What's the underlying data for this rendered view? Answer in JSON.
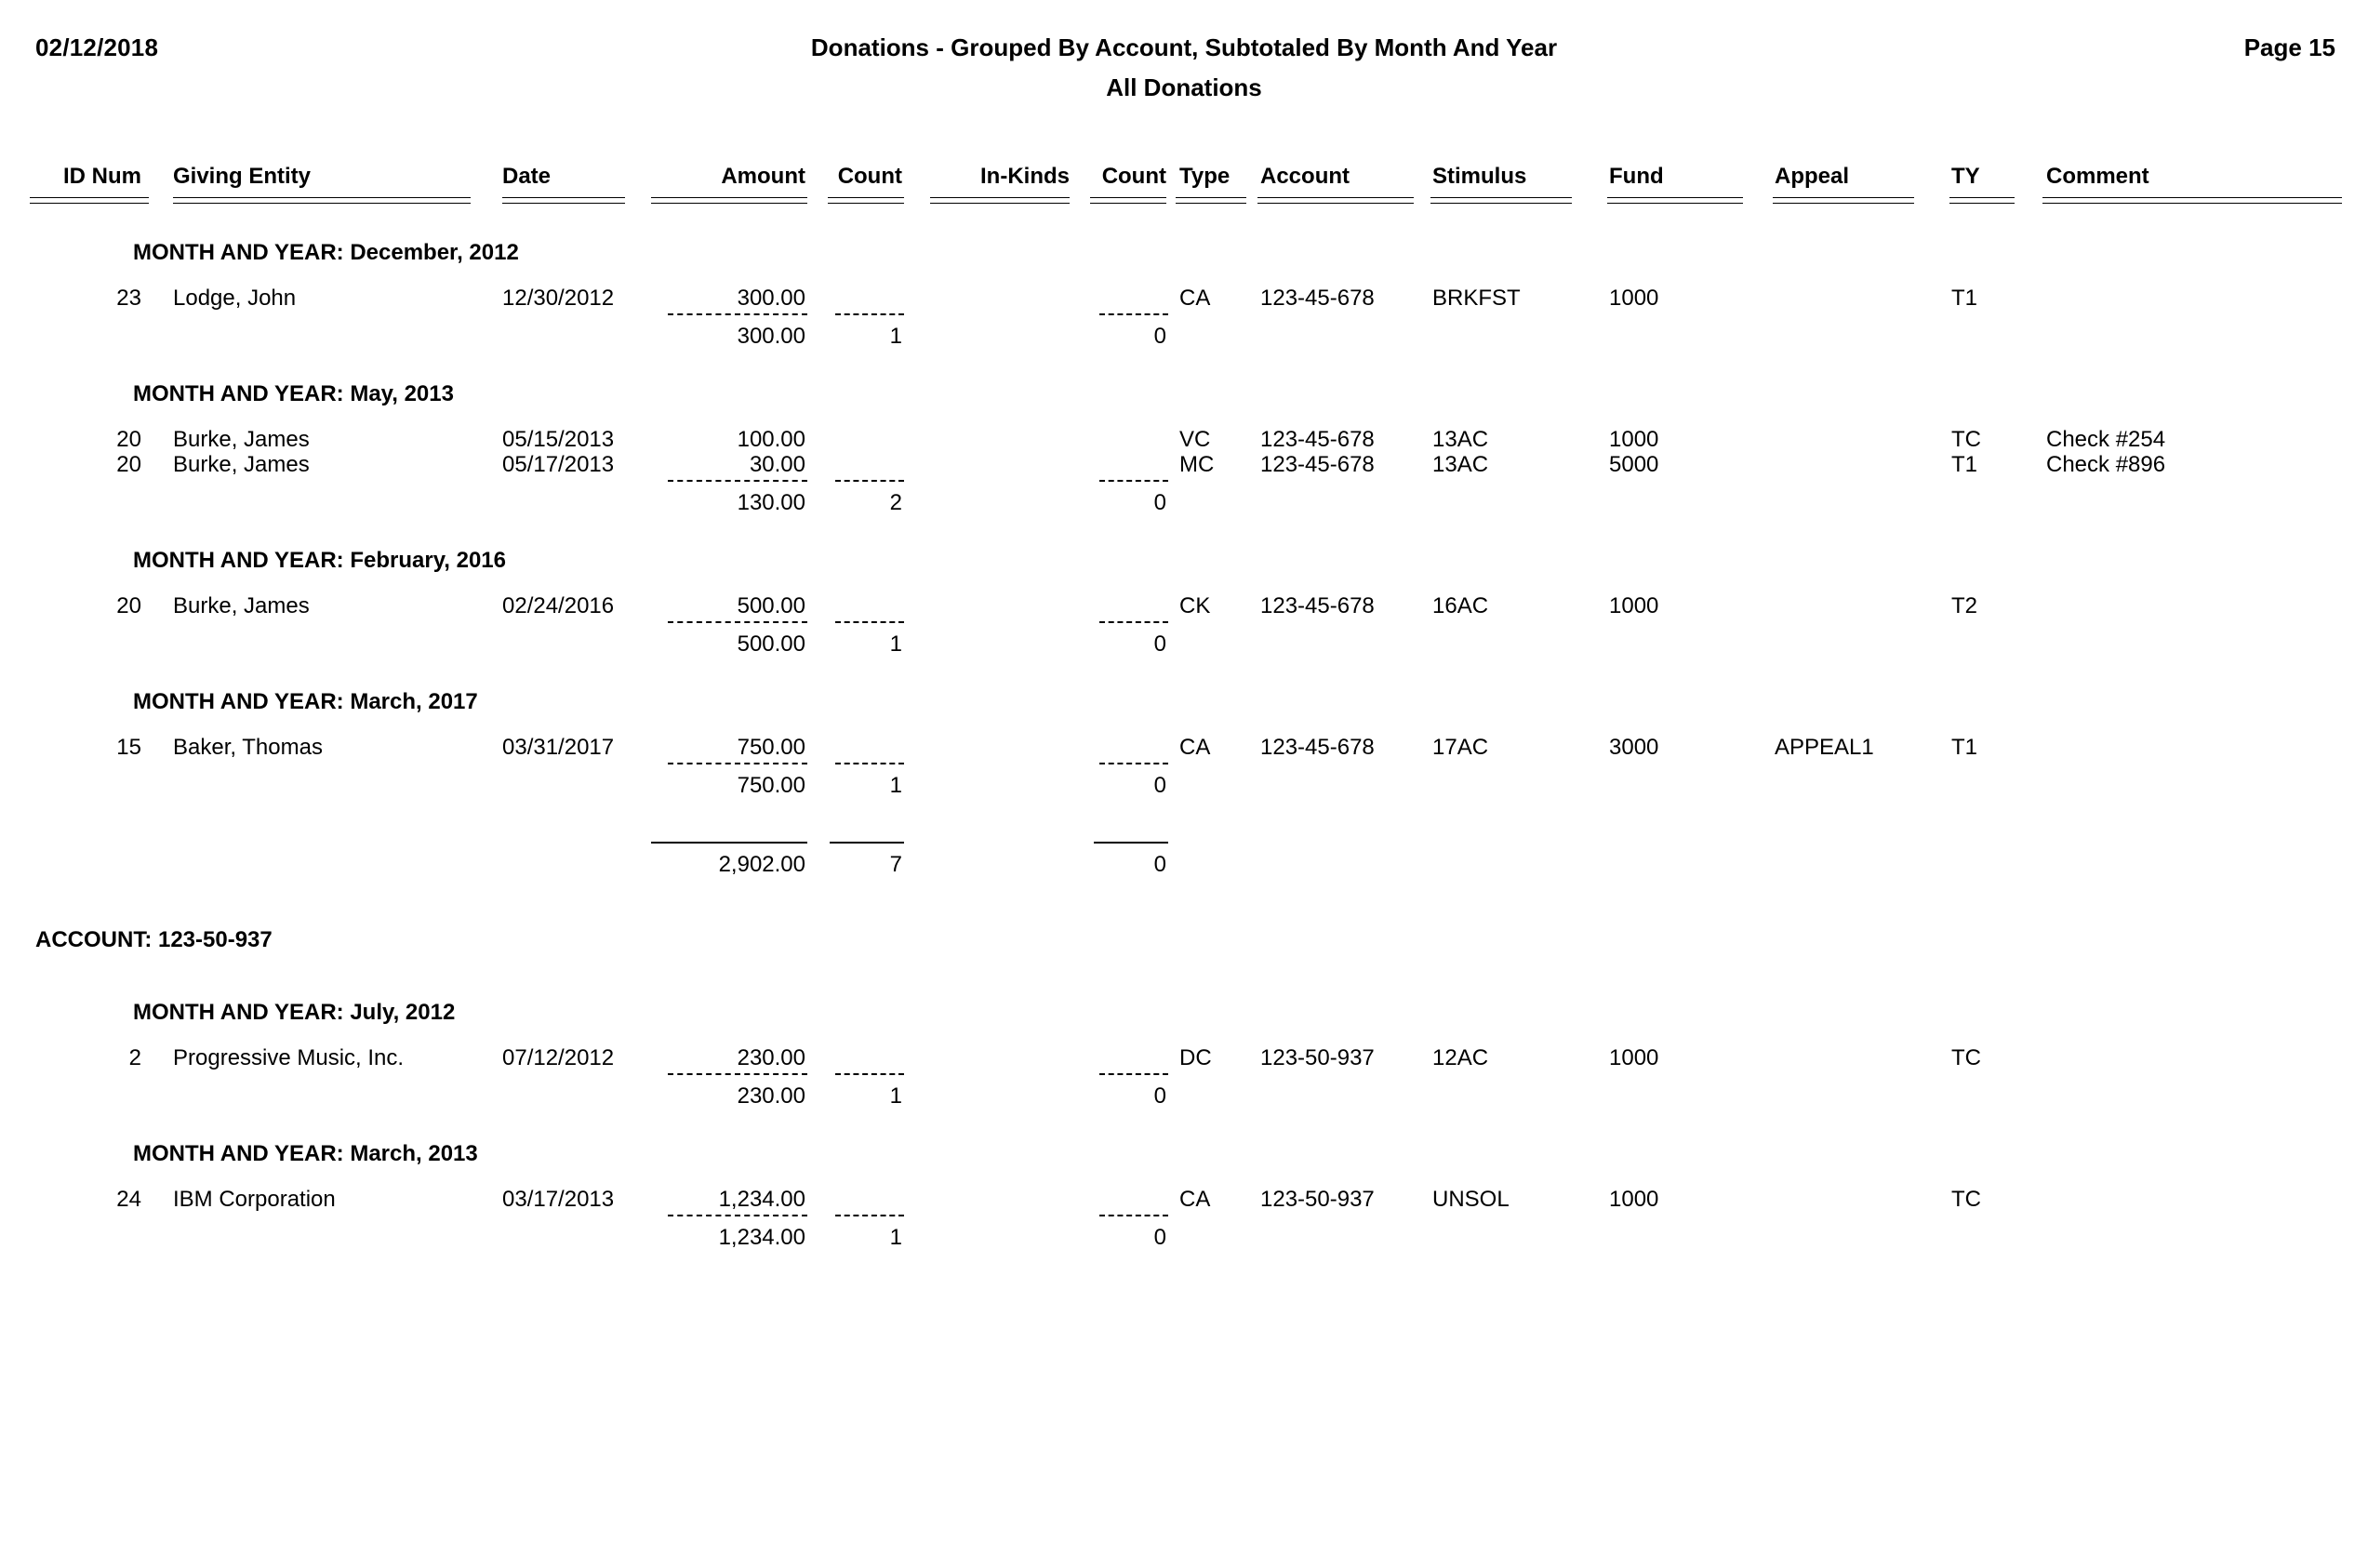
{
  "header": {
    "date": "02/12/2018",
    "title": "Donations - Grouped By Account, Subtotaled By Month And Year",
    "subtitle": "All Donations",
    "page_label": "Page 15"
  },
  "columns": {
    "id_num": "ID Num",
    "giving_entity": "Giving Entity",
    "date": "Date",
    "amount": "Amount",
    "count": "Count",
    "in_kinds": "In-Kinds",
    "count2": "Count",
    "type": "Type",
    "account": "Account",
    "stimulus": "Stimulus",
    "fund": "Fund",
    "appeal": "Appeal",
    "ty": "TY",
    "comment": "Comment"
  },
  "groups": [
    {
      "label": "MONTH AND YEAR: December, 2012",
      "rows": [
        {
          "id_num": "23",
          "giving_entity": "Lodge, John",
          "date": "12/30/2012",
          "amount": "300.00",
          "count": "",
          "in_kinds": "",
          "count2": "",
          "type": "CA",
          "account": "123-45-678",
          "stimulus": "BRKFST",
          "fund": "1000",
          "appeal": "",
          "ty": "T1",
          "comment": ""
        }
      ],
      "subtotal": {
        "amount": "300.00",
        "count": "1",
        "count2": "0"
      }
    },
    {
      "label": "MONTH AND YEAR: May, 2013",
      "rows": [
        {
          "id_num": "20",
          "giving_entity": "Burke, James",
          "date": "05/15/2013",
          "amount": "100.00",
          "count": "",
          "in_kinds": "",
          "count2": "",
          "type": "VC",
          "account": "123-45-678",
          "stimulus": "13AC",
          "fund": "1000",
          "appeal": "",
          "ty": "TC",
          "comment": "Check #254"
        },
        {
          "id_num": "20",
          "giving_entity": "Burke, James",
          "date": "05/17/2013",
          "amount": "30.00",
          "count": "",
          "in_kinds": "",
          "count2": "",
          "type": "MC",
          "account": "123-45-678",
          "stimulus": "13AC",
          "fund": "5000",
          "appeal": "",
          "ty": "T1",
          "comment": "Check #896"
        }
      ],
      "subtotal": {
        "amount": "130.00",
        "count": "2",
        "count2": "0"
      }
    },
    {
      "label": "MONTH AND YEAR: February, 2016",
      "rows": [
        {
          "id_num": "20",
          "giving_entity": "Burke, James",
          "date": "02/24/2016",
          "amount": "500.00",
          "count": "",
          "in_kinds": "",
          "count2": "",
          "type": "CK",
          "account": "123-45-678",
          "stimulus": "16AC",
          "fund": "1000",
          "appeal": "",
          "ty": "T2",
          "comment": ""
        }
      ],
      "subtotal": {
        "amount": "500.00",
        "count": "1",
        "count2": "0"
      }
    },
    {
      "label": "MONTH AND YEAR: March, 2017",
      "rows": [
        {
          "id_num": "15",
          "giving_entity": "Baker, Thomas",
          "date": "03/31/2017",
          "amount": "750.00",
          "count": "",
          "in_kinds": "",
          "count2": "",
          "type": "CA",
          "account": "123-45-678",
          "stimulus": "17AC",
          "fund": "3000",
          "appeal": "APPEAL1",
          "ty": "T1",
          "comment": ""
        }
      ],
      "subtotal": {
        "amount": "750.00",
        "count": "1",
        "count2": "0"
      }
    }
  ],
  "account_total": {
    "amount": "2,902.00",
    "count": "7",
    "count2": "0"
  },
  "account_section": {
    "label": "ACCOUNT: 123-50-937",
    "groups": [
      {
        "label": "MONTH AND YEAR: July, 2012",
        "rows": [
          {
            "id_num": "2",
            "giving_entity": "Progressive Music, Inc.",
            "date": "07/12/2012",
            "amount": "230.00",
            "count": "",
            "in_kinds": "",
            "count2": "",
            "type": "DC",
            "account": "123-50-937",
            "stimulus": "12AC",
            "fund": "1000",
            "appeal": "",
            "ty": "TC",
            "comment": ""
          }
        ],
        "subtotal": {
          "amount": "230.00",
          "count": "1",
          "count2": "0"
        }
      },
      {
        "label": "MONTH AND YEAR: March, 2013",
        "rows": [
          {
            "id_num": "24",
            "giving_entity": "IBM Corporation",
            "date": "03/17/2013",
            "amount": "1,234.00",
            "count": "",
            "in_kinds": "",
            "count2": "",
            "type": "CA",
            "account": "123-50-937",
            "stimulus": "UNSOL",
            "fund": "1000",
            "appeal": "",
            "ty": "TC",
            "comment": ""
          }
        ],
        "subtotal": {
          "amount": "1,234.00",
          "count": "1",
          "count2": "0"
        }
      }
    ]
  }
}
